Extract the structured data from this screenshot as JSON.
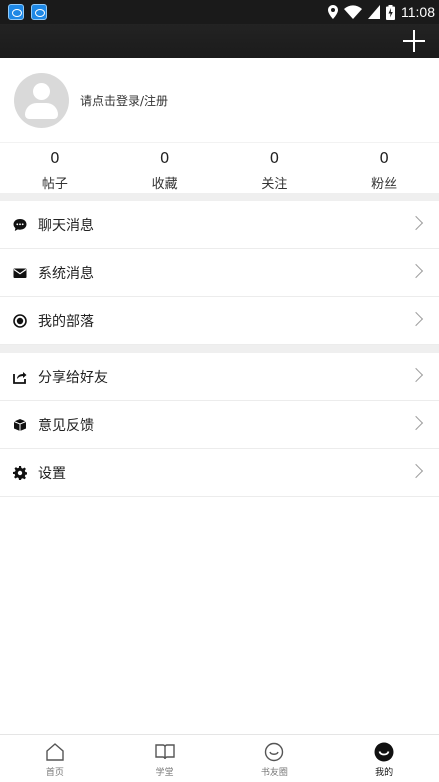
{
  "status_bar": {
    "time": "11:08"
  },
  "appbar": {
    "add_icon": "plus-icon"
  },
  "profile": {
    "login_text": "请点击登录/注册"
  },
  "stats": [
    {
      "value": "0",
      "label": "帖子"
    },
    {
      "value": "0",
      "label": "收藏"
    },
    {
      "value": "0",
      "label": "关注"
    },
    {
      "value": "0",
      "label": "粉丝"
    }
  ],
  "menu_group1": [
    {
      "label": "聊天消息",
      "icon": "chat-icon"
    },
    {
      "label": "系统消息",
      "icon": "mail-icon"
    },
    {
      "label": "我的部落",
      "icon": "target-icon"
    }
  ],
  "menu_group2": [
    {
      "label": "分享给好友",
      "icon": "share-icon"
    },
    {
      "label": "意见反馈",
      "icon": "feedback-icon"
    },
    {
      "label": "设置",
      "icon": "gear-icon"
    }
  ],
  "tabs": [
    {
      "label": "首页",
      "icon": "home-icon"
    },
    {
      "label": "学堂",
      "icon": "book-icon"
    },
    {
      "label": "书友圈",
      "icon": "smile-icon"
    },
    {
      "label": "我的",
      "icon": "profile-icon",
      "active": true
    }
  ]
}
